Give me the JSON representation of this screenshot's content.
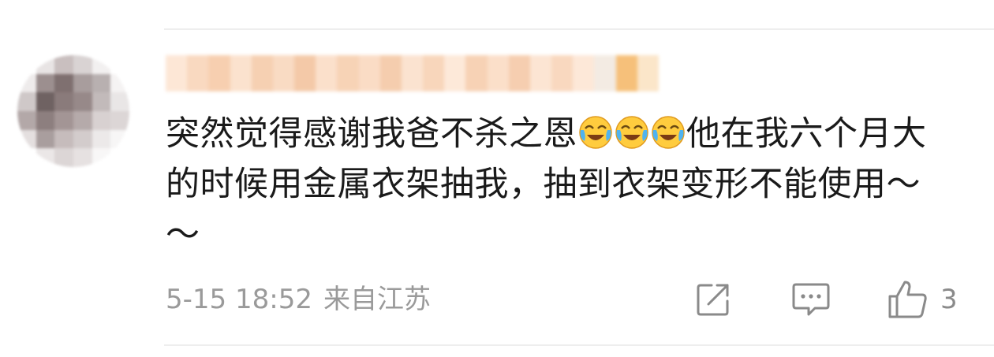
{
  "comment": {
    "text_part1": "突然觉得感谢我爸不杀之恩",
    "text_part2": "他在我六个月大的时候用金属衣架抽我，抽到衣架变形不能使用～～",
    "emojis": [
      "crying-laughing-emoji",
      "crying-laughing-emoji",
      "crying-laughing-emoji"
    ]
  },
  "meta": {
    "timestamp": "5-15 18:52",
    "location": "来自江苏"
  },
  "actions": {
    "share_icon": "share-icon",
    "reply_icon": "comment-icon",
    "like_icon": "thumbs-up-icon",
    "like_count": "3"
  },
  "colors": {
    "text": "#1a1a1a",
    "meta": "#9a9a9a",
    "icon": "#8a8a8a",
    "divider": "#eeeeee"
  }
}
